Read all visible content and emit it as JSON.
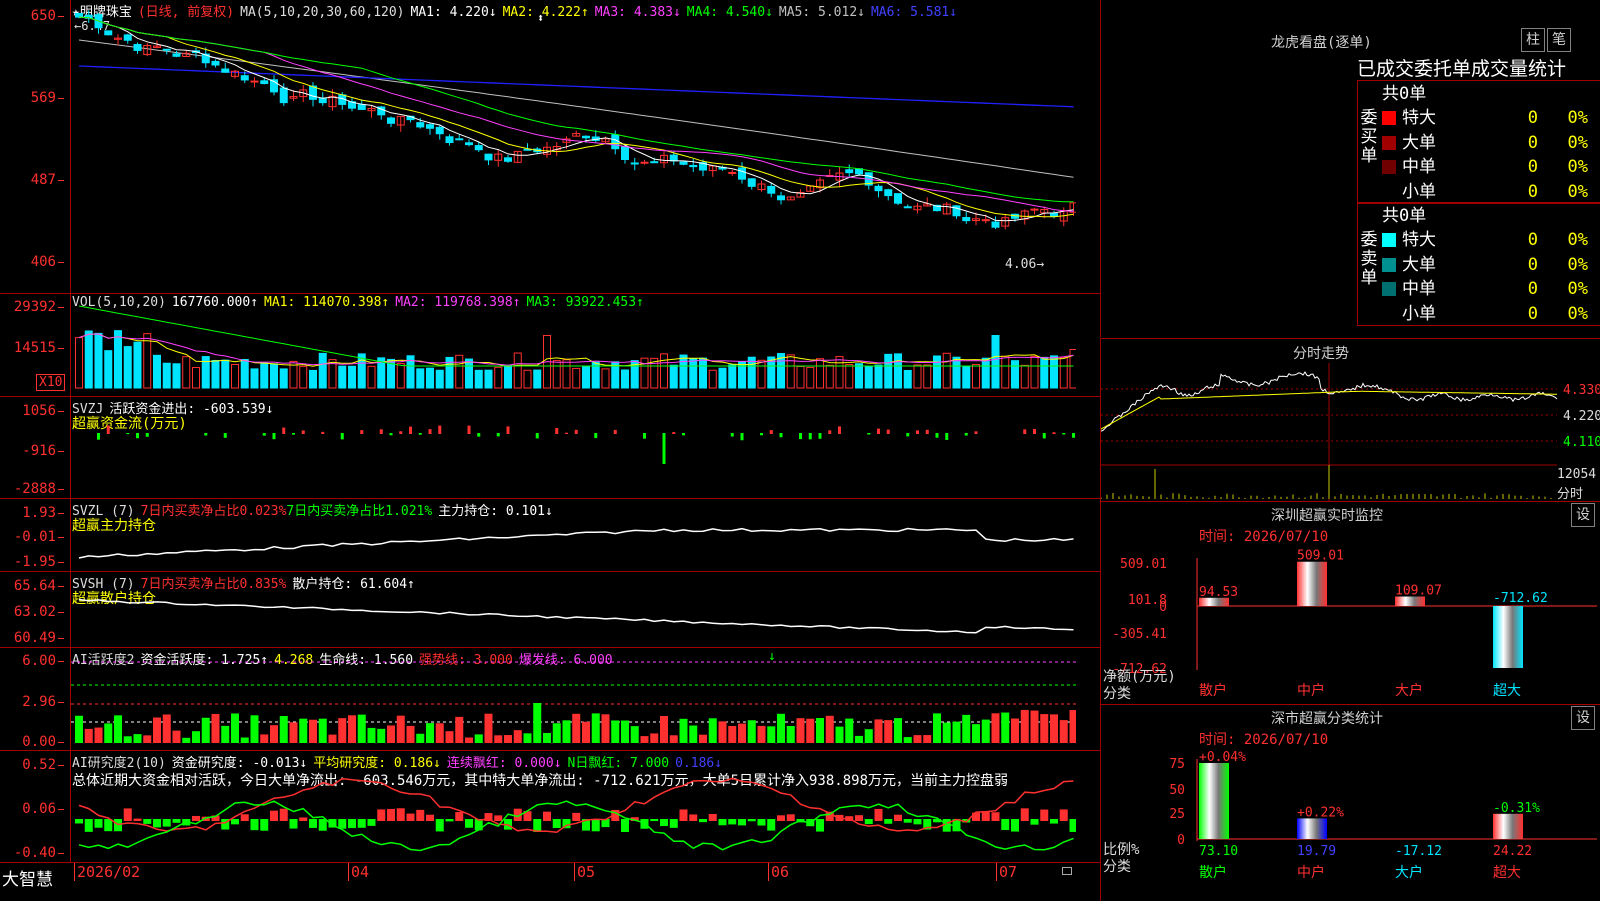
{
  "colors": {
    "up": "#ff3030",
    "down": "#00e5ff",
    "bg": "#000000",
    "grid": "#a00000",
    "ma1": "#ffffff",
    "ma2": "#ffff00",
    "ma3": "#ff40ff",
    "ma4": "#00ff00",
    "ma5": "#c0c0c0",
    "ma6": "#2020ff",
    "green": "#00ff00",
    "yellow": "#ffff00",
    "magenta": "#ff40ff"
  },
  "kline": {
    "name": "★明牌珠宝",
    "period": "(日线, 前复权)",
    "ma_label": "MA(5,10,20,30,60,120)",
    "ma1": "MA1: 4.220↓",
    "ma2": "MA2: 4.222↑",
    "ma3": "MA3: 4.383↓",
    "ma4": "MA4: 4.540↓",
    "ma5": "MA5: 5.012↓",
    "ma6": "MA6: 5.581↓",
    "yticks": [
      "650",
      "569",
      "487",
      "406"
    ],
    "high_label": "6.47",
    "low_label": "4.06"
  },
  "vol": {
    "title": "VOL(5,10,20)",
    "value": "167760.000↑",
    "ma1": "MA1: 114070.398↑",
    "ma2": "MA2: 119768.398↑",
    "ma3": "MA3: 93922.453↑",
    "yticks": [
      "29392",
      "14515"
    ],
    "unit": "X10"
  },
  "svzj": {
    "title": "SVZJ",
    "label": "活跃资金进出: -603.539↓",
    "sub": "超赢资金流(万元)",
    "yticks": [
      "1056",
      "-916",
      "-2888"
    ]
  },
  "svzl": {
    "title": "SVZL (7)",
    "a": "7日内买卖净占比0.023%",
    "b": "7日内买卖净占比1.021%",
    "c": "主力持仓: 0.101↓",
    "sub": "超赢主力持仓",
    "yticks": [
      "1.93",
      "-0.01",
      "-1.95"
    ]
  },
  "svsh": {
    "title": "SVSH (7)",
    "a": "7日内买卖净占比0.835%",
    "c": "散户持仓: 61.604↑",
    "sub": "超赢散户持仓",
    "yticks": [
      "65.64",
      "63.02",
      "60.49"
    ]
  },
  "ai1": {
    "title": "AI活跃度2",
    "a": "资金活跃度: 1.725↑",
    "b": "4.268",
    "c": "生命线: 1.560",
    "d": "强势线: 3.000",
    "e": "爆发线: 6.000",
    "yticks": [
      "6.00",
      "2.96",
      "0.00"
    ]
  },
  "ai2": {
    "title": "AI研究度2(10)",
    "a": "资金研究度: -0.013↓",
    "b": "平均研究度: 0.186↓",
    "c": "连续飘红: 0.000↓",
    "d": "N日飘红: 7.000",
    "e": "0.186↓",
    "summary": "总体近期大资金相对活跃，今日大单净流出: -603.546万元，其中特大单净流出: -712.621万元，大单5日累计净入938.898万元，当前主力控盘弱",
    "yticks": [
      "0.52",
      "0.06",
      "-0.40"
    ]
  },
  "xaxis": {
    "brand": "大智慧",
    "labels": [
      "2026/02",
      "04",
      "05",
      "06",
      "07"
    ]
  },
  "lhkp": {
    "title": "龙虎看盘(逐单)",
    "btn1": "柱",
    "btn2": "笔",
    "header": "已成交委托单成交量统计",
    "buy": {
      "side": "委买单",
      "total": "共0单",
      "rows": [
        {
          "label": "特大",
          "v": "0",
          "p": "0%",
          "c": "#ff0000"
        },
        {
          "label": "大单",
          "v": "0",
          "p": "0%",
          "c": "#a00000"
        },
        {
          "label": "中单",
          "v": "0",
          "p": "0%",
          "c": "#700000"
        },
        {
          "label": "小单",
          "v": "0",
          "p": "0%",
          "c": "#000000"
        }
      ]
    },
    "sell": {
      "side": "委卖单",
      "total": "共0单",
      "rows": [
        {
          "label": "特大",
          "v": "0",
          "p": "0%",
          "c": "#00ffff"
        },
        {
          "label": "大单",
          "v": "0",
          "p": "0%",
          "c": "#009090"
        },
        {
          "label": "中单",
          "v": "0",
          "p": "0%",
          "c": "#007070"
        },
        {
          "label": "小单",
          "v": "0",
          "p": "0%",
          "c": "#000000"
        }
      ]
    }
  },
  "fenshi": {
    "title": "分时走势",
    "p1": "4.330",
    "p2": "4.220",
    "p3": "4.110",
    "vol": "12054",
    "vlabel": "分时"
  },
  "szmon": {
    "title": "深圳超赢实时监控",
    "btn": "设",
    "time": "时间: 2026/07/10",
    "yticks": [
      "509.01",
      "101.8",
      "0",
      "-305.41",
      "-712.62"
    ],
    "bars": [
      {
        "label": "94.53",
        "cat": "散户",
        "v": 94.53
      },
      {
        "label": "509.01",
        "cat": "中户",
        "v": 509.01
      },
      {
        "label": "109.07",
        "cat": "大户",
        "v": 109.07
      },
      {
        "label": "-712.62",
        "cat": "超大",
        "v": -712.62
      }
    ],
    "ylabel1": "净额(万元)",
    "ylabel2": "分类"
  },
  "szcls": {
    "title": "深市超赢分类统计",
    "btn": "设",
    "time": "时间: 2026/07/10",
    "yticks": [
      "75",
      "50",
      "25",
      "0"
    ],
    "bars": [
      {
        "top": "+0.04%",
        "bottom": "73.10",
        "cat": "散户",
        "v": 73.1
      },
      {
        "top": "+0.22%",
        "bottom": "19.79",
        "cat": "中户",
        "v": 19.79
      },
      {
        "top": "",
        "bottom": "-17.12",
        "cat": "大户",
        "v": 0
      },
      {
        "top": "-0.31%",
        "bottom": "24.22",
        "cat": "超大",
        "v": 24.22
      }
    ],
    "ylabel1": "比例%",
    "ylabel2": "分类"
  }
}
